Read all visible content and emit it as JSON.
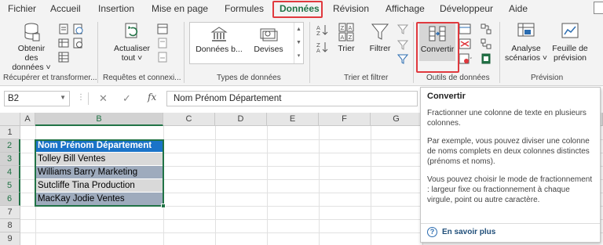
{
  "tabs": [
    "Fichier",
    "Accueil",
    "Insertion",
    "Mise en page",
    "Formules",
    "Données",
    "Révision",
    "Affichage",
    "Développeur",
    "Aide"
  ],
  "ribbon": {
    "get_data": {
      "label1": "Obtenir des",
      "label2": "données ˅"
    },
    "refresh": {
      "label1": "Actualiser",
      "label2": "tout ˅"
    },
    "data_types": {
      "item1": "Données b...",
      "item2": "Devises"
    },
    "sort": "Trier",
    "filter": "Filtrer",
    "convert": "Convertir",
    "analysis": {
      "label1": "Analyse",
      "label2": "scénarios ˅"
    },
    "forecast": {
      "label1": "Feuille de",
      "label2": "prévision"
    },
    "groups": {
      "get_transform": "Récupérer et transformer...",
      "queries": "Requêtes et connexi...",
      "types": "Types de données",
      "sort_filter": "Trier et filtrer",
      "tools": "Outils de données",
      "forecast": "Prévision"
    }
  },
  "formula_bar": {
    "name_box": "B2",
    "cancel_icon": "✕",
    "enter_icon": "✓",
    "fx": "fx",
    "content": "Nom Prénom Département"
  },
  "grid": {
    "columns": [
      "A",
      "B",
      "C",
      "D",
      "E",
      "F",
      "G"
    ],
    "rows": [
      "1",
      "2",
      "3",
      "4",
      "5",
      "6",
      "7",
      "8",
      "9"
    ],
    "cells": [
      "Nom Prénom Département",
      "Tolley Bill Ventes",
      "Williams Barry Marketing",
      "Sutcliffe Tina Production",
      "MacKay Jodie Ventes"
    ]
  },
  "tooltip": {
    "title": "Convertir",
    "p1": "Fractionner une colonne de texte en plusieurs colonnes.",
    "p2": "Par exemple, vous pouvez diviser une colonne de noms complets en deux colonnes distinctes (prénoms et noms).",
    "p3": "Vous pouvez choisir le mode de fractionnement : largeur fixe ou fractionnement à chaque virgule, point ou autre caractère.",
    "link": "En savoir plus"
  },
  "colors": {
    "accent": "#217346",
    "highlight": "#e0393e",
    "header_cell": "#1a73c8",
    "band_light": "#d9d9d9",
    "band_dark": "#9eabbd"
  },
  "icons": [
    "database-icon",
    "refresh-icon",
    "bank-icon",
    "currency-icon",
    "sort-az-icon",
    "funnel-icon",
    "text-to-columns-icon",
    "what-if-icon",
    "forecast-sheet-icon",
    "help-icon"
  ]
}
